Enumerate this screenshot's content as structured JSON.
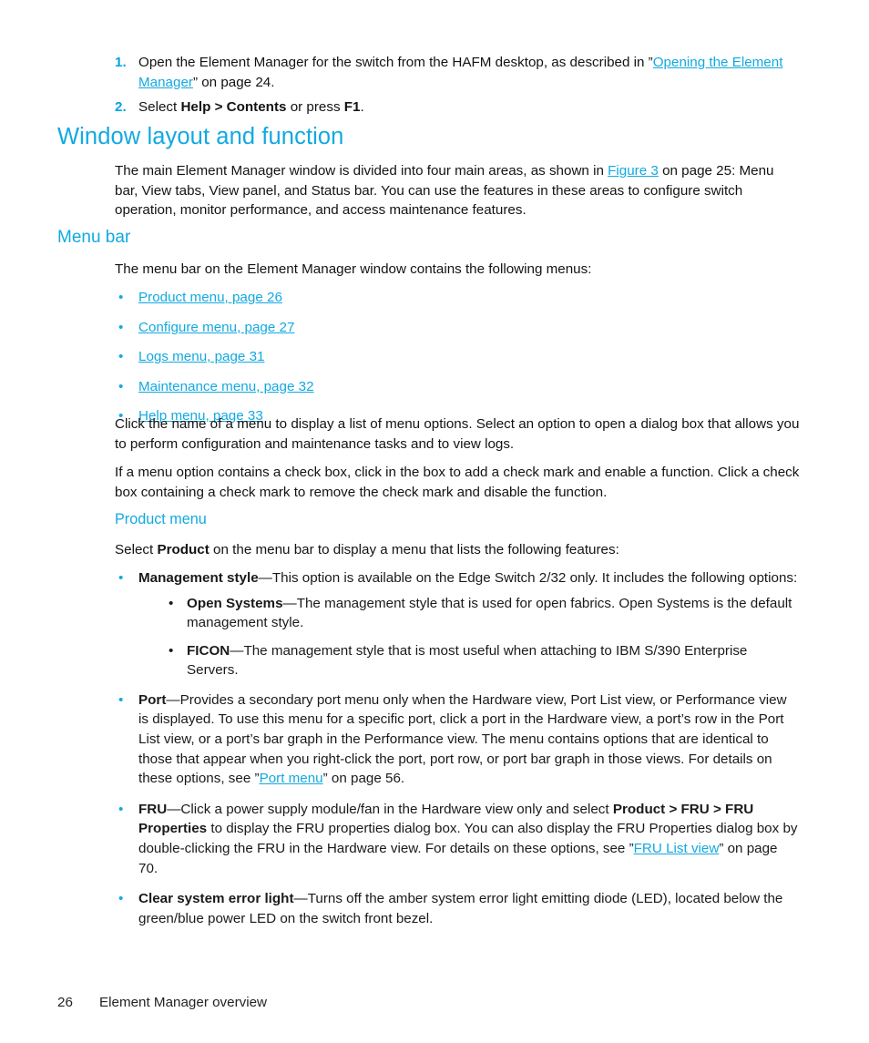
{
  "document": {
    "footer": {
      "page_number": "26",
      "chapter_title": "Element Manager overview"
    }
  },
  "procedure": {
    "items": [
      {
        "marker": "1.",
        "pre": "Open the Element Manager for the switch from the HAFM desktop, as described in ”",
        "link": "Opening the Element Manager",
        "post": "” on page 24."
      },
      {
        "marker": "2.",
        "pre": "Select ",
        "bold1": "Help > Contents",
        "mid": " or press ",
        "bold2": "F1",
        "post": "."
      }
    ]
  },
  "section_window_layout": {
    "heading": "Window layout and function",
    "intro_pre": "The main Element Manager window is divided into four main areas, as shown in ",
    "intro_link": "Figure 3",
    "intro_post": " on page 25: Menu bar, View tabs, View panel, and Status bar. You can use the features in these areas to configure switch operation, monitor performance, and access maintenance features."
  },
  "section_menu_bar": {
    "heading": "Menu bar",
    "intro": "The menu bar on the Element Manager window contains the following menus:",
    "menu_links": [
      "Product menu, page 26",
      "Configure menu, page 27",
      "Logs menu, page 31",
      "Maintenance menu, page 32",
      "Help menu, page 33"
    ],
    "para_click": "Click the name of a menu to display a list of menu options. Select an option to open a dialog box that allows you to perform configuration and maintenance tasks and to view logs.",
    "para_checkbox": "If a menu option contains a check box, click in the box to add a check mark and enable a function. Click a check box containing a check mark to remove the check mark and disable the function."
  },
  "section_product_menu": {
    "heading": "Product menu",
    "intro_pre": "Select ",
    "intro_bold": "Product",
    "intro_post": " on the menu bar to display a menu that lists the following features:",
    "features": {
      "management_style": {
        "term": "Management style",
        "desc": "—This option is available on the Edge Switch 2/32 only. It includes the following options:",
        "sub_options": [
          {
            "term": "Open Systems",
            "desc": "—The management style that is used for open fabrics. Open Systems is the default management style."
          },
          {
            "term": "FICON",
            "desc": "—The management style that is most useful when attaching to IBM S/390 Enterprise Servers."
          }
        ]
      },
      "port": {
        "term": "Port",
        "desc_pre": "—Provides a secondary port menu only when the Hardware view, Port List view, or Performance view is displayed. To use this menu for a specific port, click a port in the Hardware view, a port’s row in the Port List view, or a port’s bar graph in the Performance view. The menu contains options that are identical to those that appear when you right-click the port, port row, or port bar graph in those views. For details on these options, see ”",
        "link": "Port menu",
        "desc_post": "” on page 56."
      },
      "fru": {
        "term": "FRU",
        "desc_pre": "—Click a power supply module/fan in the Hardware view only and select ",
        "bold_path": "Product > FRU > FRU Properties",
        "desc_mid": " to display the FRU properties dialog box. You can also display the FRU Properties dialog box by double-clicking the FRU in the Hardware view. For details on these options, see ”",
        "link": "FRU List view",
        "desc_post": "” on page 70."
      },
      "clear_system_error_light": {
        "term": "Clear system error light",
        "desc": "—Turns off the amber system error light emitting diode (LED), located below the green/blue power LED on the switch front bezel."
      }
    }
  },
  "bullet_glyph": "•",
  "colors": {
    "accent_blue": "#12A9E0",
    "link_blue": "#12A9E0",
    "body_text": "#131313",
    "page_background": "#ffffff"
  }
}
